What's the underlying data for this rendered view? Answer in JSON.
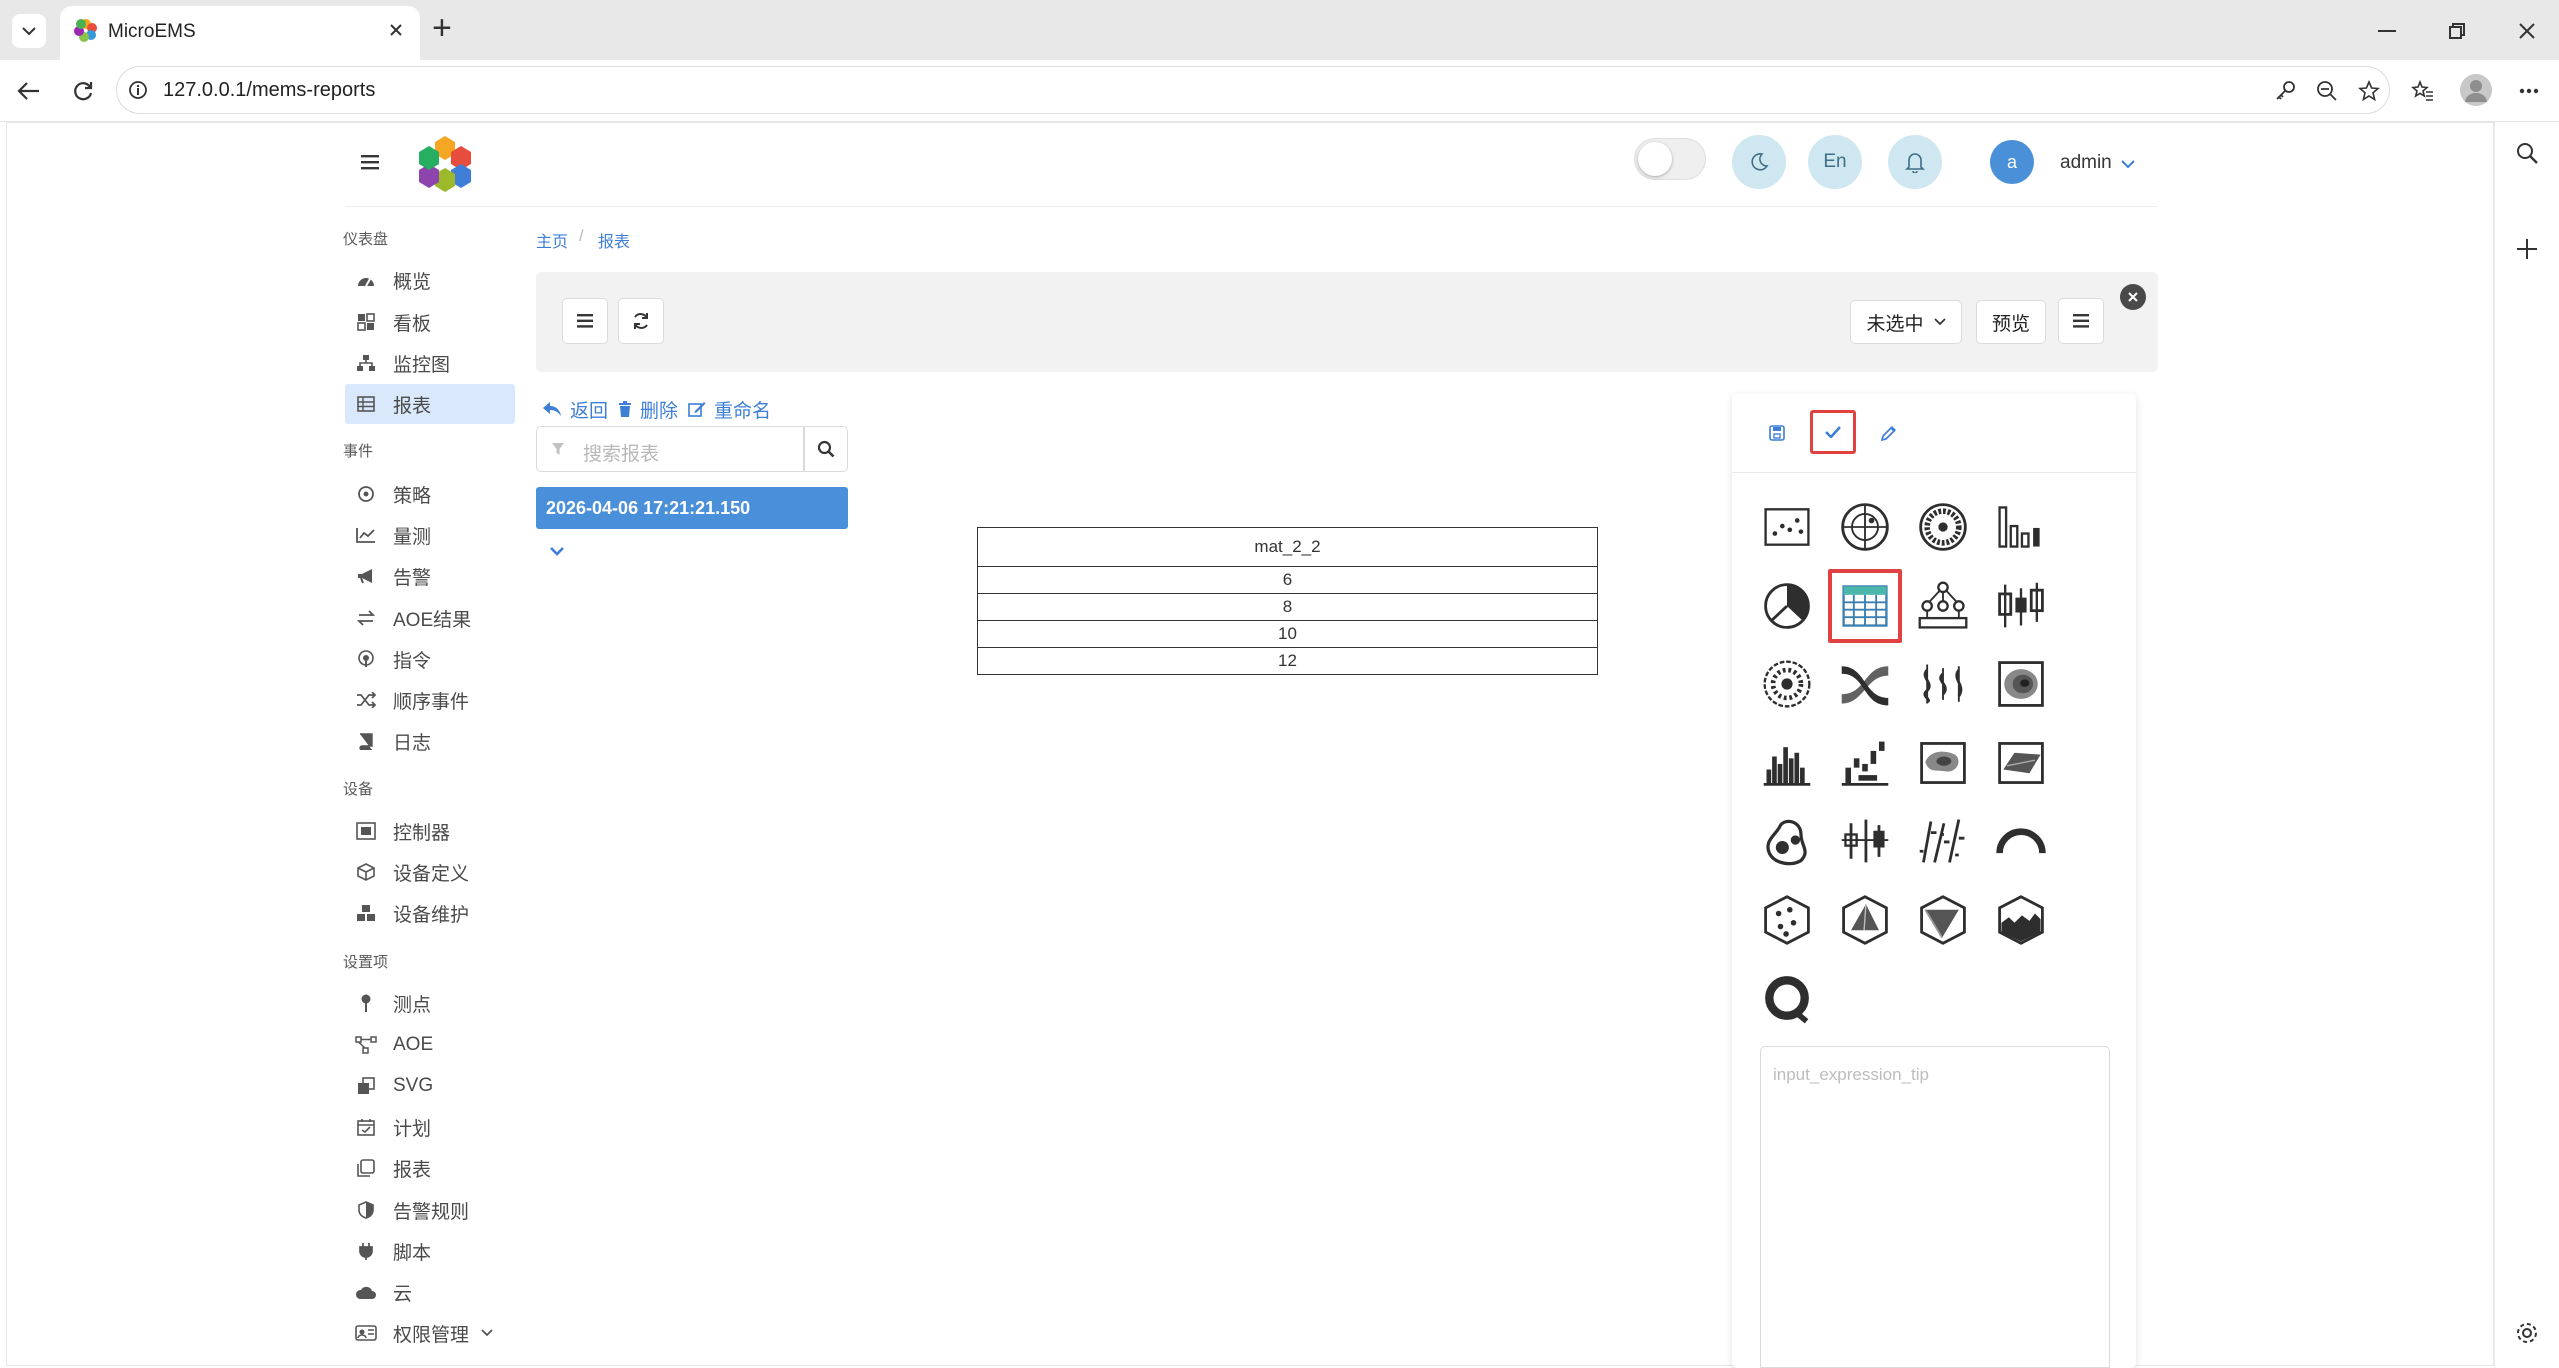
{
  "browser": {
    "tab_title": "MicroEMS",
    "url": "127.0.0.1/mems-reports",
    "new_tab_symbol": "+"
  },
  "header": {
    "lang_button": "En",
    "avatar_letter": "a",
    "user_name": "admin"
  },
  "sidebar": {
    "sections": [
      {
        "title": "仪表盘",
        "items": [
          "概览",
          "看板",
          "监控图",
          "报表"
        ]
      },
      {
        "title": "事件",
        "items": [
          "策略",
          "量测",
          "告警",
          "AOE结果",
          "指令",
          "顺序事件",
          "日志"
        ]
      },
      {
        "title": "设备",
        "items": [
          "控制器",
          "设备定义",
          "设备维护"
        ]
      },
      {
        "title": "设置项",
        "items": [
          "测点",
          "AOE",
          "SVG",
          "计划",
          "报表",
          "告警规则",
          "脚本",
          "云",
          "权限管理"
        ]
      }
    ],
    "active_item": "报表"
  },
  "breadcrumb": {
    "home": "主页",
    "separator": "/",
    "current": "报表"
  },
  "toolbar": {
    "select_label": "未选中",
    "preview_label": "预览"
  },
  "report_actions": {
    "back": "返回",
    "delete": "删除",
    "rename": "重命名"
  },
  "search": {
    "placeholder": "搜索报表"
  },
  "report_list": {
    "selected_item": "2026-04-06 17:21:21.150"
  },
  "table": {
    "header": "mat_2_2",
    "rows": [
      "6",
      "8",
      "10",
      "12"
    ]
  },
  "chart_panel": {
    "expression_placeholder": "input_expression_tip",
    "icons": [
      "scatter-chart-icon",
      "polar-chart-icon",
      "radial-chart-icon",
      "bar-chart-icon",
      "pie-chart-icon",
      "table-chart-icon",
      "tree-chart-icon",
      "candlestick-chart-icon",
      "sunburst-chart-icon",
      "sankey-chart-icon",
      "violin-chart-icon",
      "contour-chart-icon",
      "histogram-chart-icon",
      "waterfall-chart-icon",
      "heatmap-chart-icon",
      "surface-chart-icon",
      "blob-chart-icon",
      "boxplot-chart-icon",
      "ohlc-chart-icon",
      "gauge-chart-icon",
      "scatter3d-chart-icon",
      "mesh3d-chart-icon",
      "cone3d-chart-icon",
      "area3d-chart-icon",
      "ring-chart-icon"
    ],
    "selected_icon": "table-chart-icon"
  },
  "colors": {
    "accent": "#3e7fd6",
    "active_nav": "#d9e8fb",
    "selected_report": "#4a8fd9",
    "highlight_border": "#e04141",
    "toolbar_bg": "#f2f2f2"
  }
}
